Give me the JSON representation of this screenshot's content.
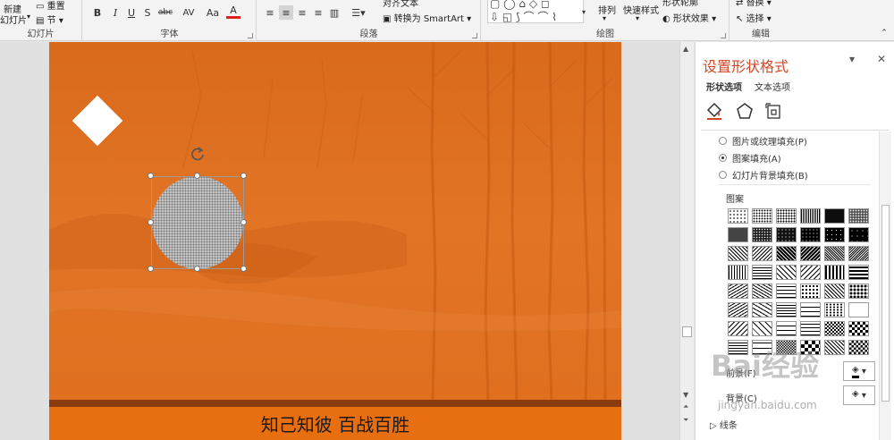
{
  "ribbon": {
    "slides_group": {
      "label": "幻灯片",
      "new_slide": "新建",
      "new_slide_line2": "幻灯片",
      "reset": "重置",
      "section": "节"
    },
    "font_group": {
      "label": "字体",
      "bold": "B",
      "italic": "I",
      "underline": "U",
      "shadow": "S",
      "strike": "abc",
      "spacing": "AV",
      "case": "Aa",
      "color": "A"
    },
    "paragraph_group": {
      "label": "段落",
      "align_text": "对齐文本",
      "smartart": "转换为 SmartArt"
    },
    "drawing_group": {
      "label": "绘图",
      "arrange": "排列",
      "quick_styles": "快速样式",
      "shape_outline": "形状轮廓",
      "shape_effects": "形状效果"
    },
    "editing_group": {
      "label": "编辑",
      "replace": "替换",
      "select": "选择"
    }
  },
  "slide": {
    "footer_text": "知己知彼 百战百胜",
    "colors": {
      "background": "#df6f1e",
      "footer": "#e86f10",
      "stripe": "#8a3c0e"
    }
  },
  "pane": {
    "title": "设置形状格式",
    "tabs": [
      "形状选项",
      "文本选项"
    ],
    "fill_options": [
      {
        "label": "图片或纹理填充(P)",
        "selected": false
      },
      {
        "label": "图案填充(A)",
        "selected": true
      },
      {
        "label": "幻灯片背景填充(B)",
        "selected": false
      }
    ],
    "pattern_label": "图案",
    "foreground_label": "前景(F)",
    "background_label": "背景(C)",
    "section_line": "线条"
  },
  "watermark": {
    "logo": "Bai经验",
    "url": "jingyan.baidu.com"
  }
}
